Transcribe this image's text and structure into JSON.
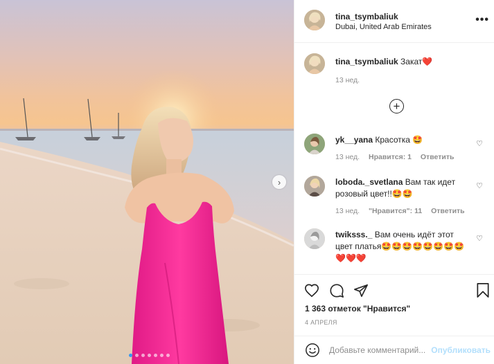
{
  "post": {
    "author": "tina_tsymbaliuk",
    "location": "Dubai, United Arab Emirates",
    "more_label": "•••",
    "next_label": "›",
    "carousel": {
      "count": 7,
      "active_index": 0
    }
  },
  "caption": {
    "username": "tina_tsymbaliuk",
    "text": "Закат",
    "emoji": "❤️",
    "time": "13 нед."
  },
  "load_more_label": "+",
  "comments": [
    {
      "username": "yk__yana",
      "text": "Красотка 🤩",
      "time": "13 нед.",
      "likes": "Нравится: 1",
      "reply": "Ответить"
    },
    {
      "username": "loboda._svetlana",
      "text": "Вам так идет розовый цвет!!🤩🤩",
      "time": "13 нед.",
      "likes": "\"Нравится\": 11",
      "reply": "Ответить"
    },
    {
      "username": "twiksss._",
      "text": "Вам очень идёт этот цвет платья🤩🤩🤩🤩🤩🤩🤩🤩❤️❤️❤️"
    }
  ],
  "likes_text": "1 363 отметок \"Нравится\"",
  "date_text": "4 АПРЕЛЯ",
  "add_comment": {
    "placeholder": "Добавьте комментарий...",
    "publish": "Опубликовать"
  },
  "colors": {
    "accent": "#3897f0",
    "publish_disabled": "#b2dffc",
    "dress": "#f0288e",
    "text": "#262626",
    "muted": "#8e8e8e"
  }
}
